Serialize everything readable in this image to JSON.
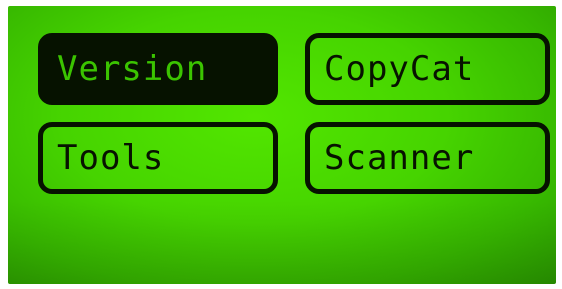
{
  "menu": {
    "items": [
      {
        "label": "Version",
        "selected": true
      },
      {
        "label": "CopyCat",
        "selected": false
      },
      {
        "label": "Tools",
        "selected": false
      },
      {
        "label": "Scanner",
        "selected": false
      }
    ]
  },
  "colors": {
    "screen": "#46d400",
    "ink": "#061200"
  }
}
